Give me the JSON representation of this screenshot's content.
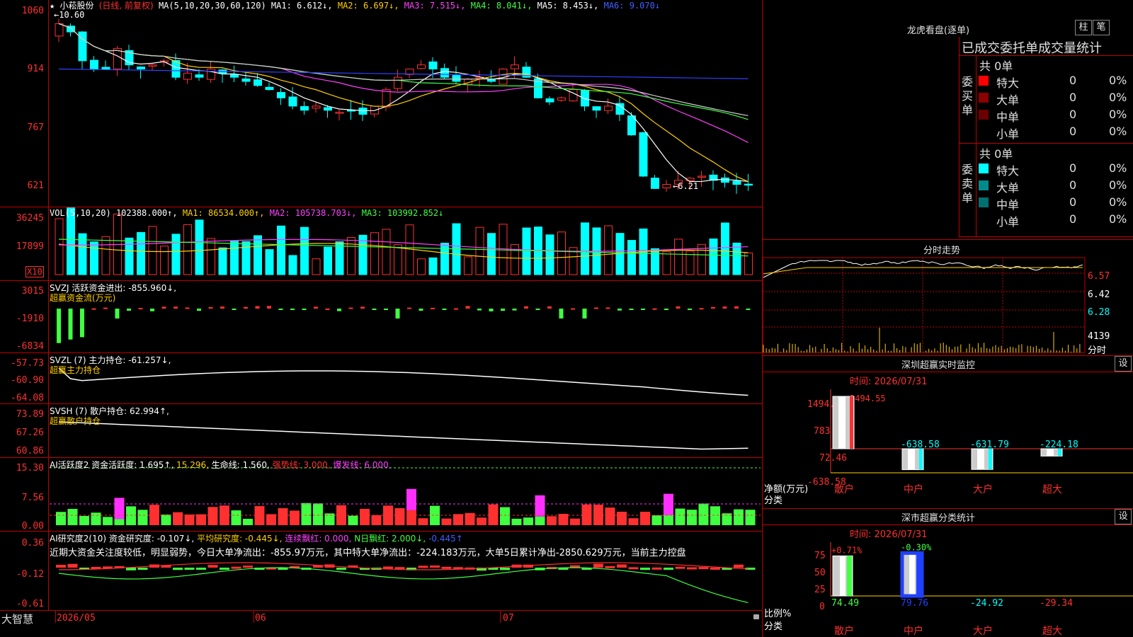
{
  "main": {
    "star": "★",
    "stock_name": "小菘股份",
    "mode": "(日线, 前复权)",
    "ma_params": "MA(5,10,20,30,60,120)",
    "ma1": "MA1: 6.612↓,",
    "ma2": "MA2: 6.697↓,",
    "ma3": "MA3: 7.515↓,",
    "ma4": "MA4: 8.041↓,",
    "ma5": "MA5: 8.453↓,",
    "ma6": "MA6: 9.070↓",
    "high_label": "←10.60",
    "low_label": "←6.21",
    "yticks": [
      "1060",
      "914",
      "767",
      "621"
    ]
  },
  "vol": {
    "label": "VOL(5,10,20)",
    "value": "102388.000↑,",
    "ma1": "MA1: 86534.000↑,",
    "ma2": "MA2: 105738.703↓,",
    "ma3": "MA3: 103992.852↓",
    "yticks": [
      "36245",
      "17899"
    ],
    "unit": "X10"
  },
  "svzj": {
    "label": "SVZJ  活跃资金进出: -855.960↓,",
    "sub": "超赢资金流(万元)",
    "yticks": [
      "3015",
      "-1910",
      "-6834"
    ]
  },
  "svzl": {
    "label": "SVZL (7) 主力持仓: -61.257↓,",
    "sub": "超赢主力持仓",
    "yticks": [
      "-57.73",
      "-60.90",
      "-64.08"
    ]
  },
  "svsh": {
    "label": "SVSH (7) 散户持仓: 62.994↑,",
    "sub": "超赢散户持仓",
    "yticks": [
      "73.89",
      "67.26",
      "60.86"
    ]
  },
  "ai1": {
    "label": "AI活跃度2 资金活跃度: 1.695↑,",
    "v2": "15.296,",
    "v3": "生命线: 1.560,",
    "v4": "强势线: 3.000,",
    "v5": "爆发线: 6.000,",
    "yticks": [
      "15.30",
      "7.56",
      "0.00"
    ]
  },
  "ai2": {
    "label": "AI研究度2(10) 资金研究度: -0.107↓,",
    "v2": "平均研究度: -0.445↓,",
    "v3": "连续飘红: 0.000,",
    "v4": "N日飘红: 2.000↓,",
    "v5": "-0.445↑",
    "comment": "近期大资金关注度较低，明显弱势，今日大单净流出：-855.97万元，其中特大单净流出：-224.183万元，大单5日累计净出-2850.629万元，当前主力控盘",
    "yticks": [
      "0.36",
      "-0.12",
      "-0.61"
    ]
  },
  "bottom": {
    "brand": "大智慧",
    "dates": [
      "2026/05",
      "06",
      "07"
    ]
  },
  "longhu": {
    "title": "龙虎看盘(逐单)",
    "btn1": "柱",
    "btn2": "笔",
    "subtitle": "已成交委托单成交量统计",
    "buy_side": "委买单",
    "sell_side": "委卖单",
    "buy_total": "共 0单",
    "sell_total": "共 0单",
    "buy_rows": [
      {
        "name": "特大",
        "val": "0",
        "pct": "0%",
        "color": "#ff0000"
      },
      {
        "name": "大单",
        "val": "0",
        "pct": "0%",
        "color": "#8b0000"
      },
      {
        "name": "中单",
        "val": "0",
        "pct": "0%",
        "color": "#6b0000"
      },
      {
        "name": "小单",
        "val": "0",
        "pct": "0%",
        "color": "#000000"
      }
    ],
    "sell_rows": [
      {
        "name": "特大",
        "val": "0",
        "pct": "0%",
        "color": "#00ffff"
      },
      {
        "name": "大单",
        "val": "0",
        "pct": "0%",
        "color": "#008b8b"
      },
      {
        "name": "中单",
        "val": "0",
        "pct": "0%",
        "color": "#007070"
      },
      {
        "name": "小单",
        "val": "0",
        "pct": "0%",
        "color": "#000000"
      }
    ]
  },
  "intraday": {
    "title": "分时走势",
    "yticks": [
      "6.57",
      "6.42",
      "6.28"
    ],
    "vol_tick": "4139",
    "vol_label": "分时"
  },
  "monitor": {
    "title": "深圳超赢实时监控",
    "btn": "设",
    "time": "时间: 2026/07/31",
    "yticks": [
      "1494.55",
      "783.51",
      "72.46",
      "-638.58"
    ],
    "ylabel": "净额(万元)",
    "xlabel": "分类",
    "top_value": "1494.55",
    "bars": [
      {
        "name": "散户",
        "value": 1494.55,
        "label": "1494.55"
      },
      {
        "name": "中户",
        "value": -638.58,
        "label": "-638.58"
      },
      {
        "name": "大户",
        "value": -631.79,
        "label": "-631.79"
      },
      {
        "name": "超大",
        "value": -224.18,
        "label": "-224.18"
      }
    ]
  },
  "category": {
    "title": "深市超赢分类统计",
    "btn": "设",
    "time": "时间: 2026/07/31",
    "yticks": [
      "75",
      "50",
      "25",
      "0"
    ],
    "ylabel": "比例%",
    "xlabel": "分类",
    "bars": [
      {
        "name": "散户",
        "top": "+0.71%",
        "value": "74.49",
        "pct": 74.49
      },
      {
        "name": "中户",
        "top": "-0.30%",
        "value": "79.76",
        "pct": 79.76
      },
      {
        "name": "大户",
        "top": "",
        "value": "-24.92",
        "pct": 0
      },
      {
        "name": "超大",
        "top": "",
        "value": "-29.34",
        "pct": 0
      }
    ]
  }
}
